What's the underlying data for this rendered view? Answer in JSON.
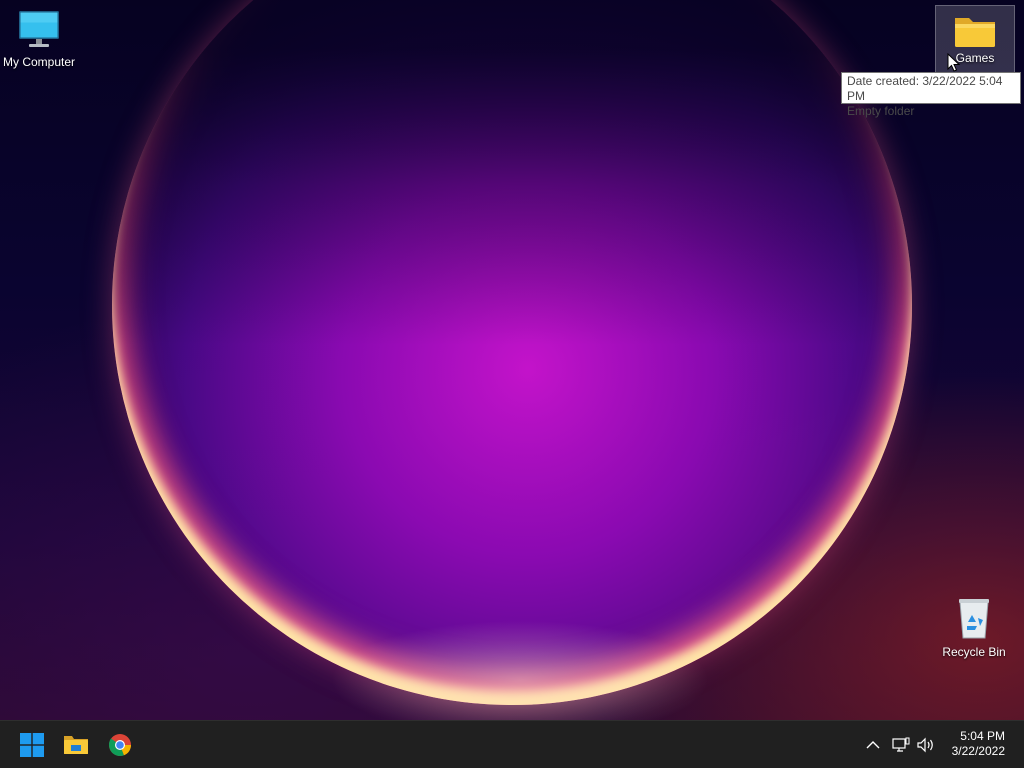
{
  "desktop": {
    "icons": {
      "my_computer": {
        "label": "My Computer",
        "icon": "monitor-icon"
      },
      "games": {
        "label": "Games",
        "icon": "folder-icon"
      },
      "recycle_bin": {
        "label": "Recycle Bin",
        "icon": "recycle-bin-icon"
      }
    },
    "tooltip": {
      "line1": "Date created: 3/22/2022 5:04 PM",
      "line2": "Empty folder"
    }
  },
  "taskbar": {
    "pinned": [
      {
        "name": "start",
        "icon": "windows-logo-icon"
      },
      {
        "name": "file-explorer",
        "icon": "folder-icon"
      },
      {
        "name": "chrome",
        "icon": "chrome-icon"
      }
    ],
    "tray": {
      "chevron": "chevron-up-icon",
      "network": "network-icon",
      "volume": "speaker-icon"
    },
    "clock": {
      "time": "5:04 PM",
      "date": "3/22/2022"
    }
  },
  "colors": {
    "taskbar_bg": "#202020",
    "folder_yellow": "#f8c938",
    "windows_blue": "#1e9bf0",
    "monitor_blue": "#2fb4e8"
  }
}
